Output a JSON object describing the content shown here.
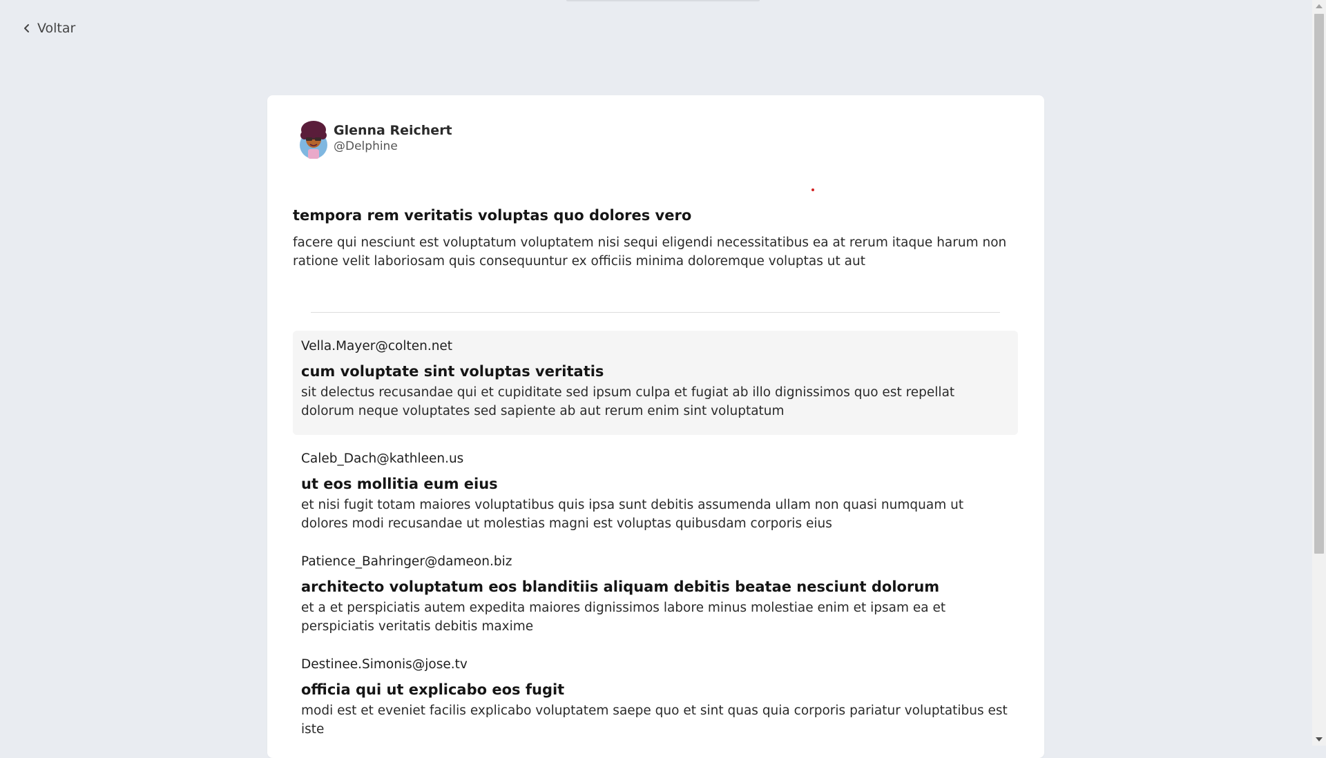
{
  "nav": {
    "back_label": "Voltar"
  },
  "post": {
    "author_name": "Glenna Reichert",
    "author_handle": "@Delphine",
    "title": "tempora rem veritatis voluptas quo dolores vero",
    "body": "facere qui nesciunt est voluptatum voluptatem nisi sequi eligendi necessitatibus ea at rerum itaque harum non ratione velit laboriosam quis consequuntur ex officiis minima doloremque voluptas ut aut"
  },
  "comments": [
    {
      "email": "Vella.Mayer@colten.net",
      "title": "cum voluptate sint voluptas veritatis",
      "body": "sit delectus recusandae qui et cupiditate sed ipsum culpa et fugiat ab illo dignissimos quo est repellat dolorum neque voluptates sed sapiente ab aut rerum enim sint voluptatum"
    },
    {
      "email": "Caleb_Dach@kathleen.us",
      "title": "ut eos mollitia eum eius",
      "body": "et nisi fugit totam maiores voluptatibus quis ipsa sunt debitis assumenda ullam non quasi numquam ut dolores modi recusandae ut molestias magni est voluptas quibusdam corporis eius"
    },
    {
      "email": "Patience_Bahringer@dameon.biz",
      "title": "architecto voluptatum eos blanditiis aliquam debitis beatae nesciunt dolorum",
      "body": "et a et perspiciatis autem expedita maiores dignissimos labore minus molestiae enim et ipsam ea et perspiciatis veritatis debitis maxime"
    },
    {
      "email": "Destinee.Simonis@jose.tv",
      "title": "officia qui ut explicabo eos fugit",
      "body": "modi est et eveniet facilis explicabo voluptatem saepe quo et sint quas quia corporis pariatur voluptatibus est iste"
    }
  ],
  "colors": {
    "page_background": "#e9ecf1",
    "card_background": "#ffffff",
    "highlight_background": "#f5f5f5",
    "accent_dot": "#d32222"
  },
  "icons": {
    "back": "chevron-left-icon",
    "avatar": "avatar"
  }
}
